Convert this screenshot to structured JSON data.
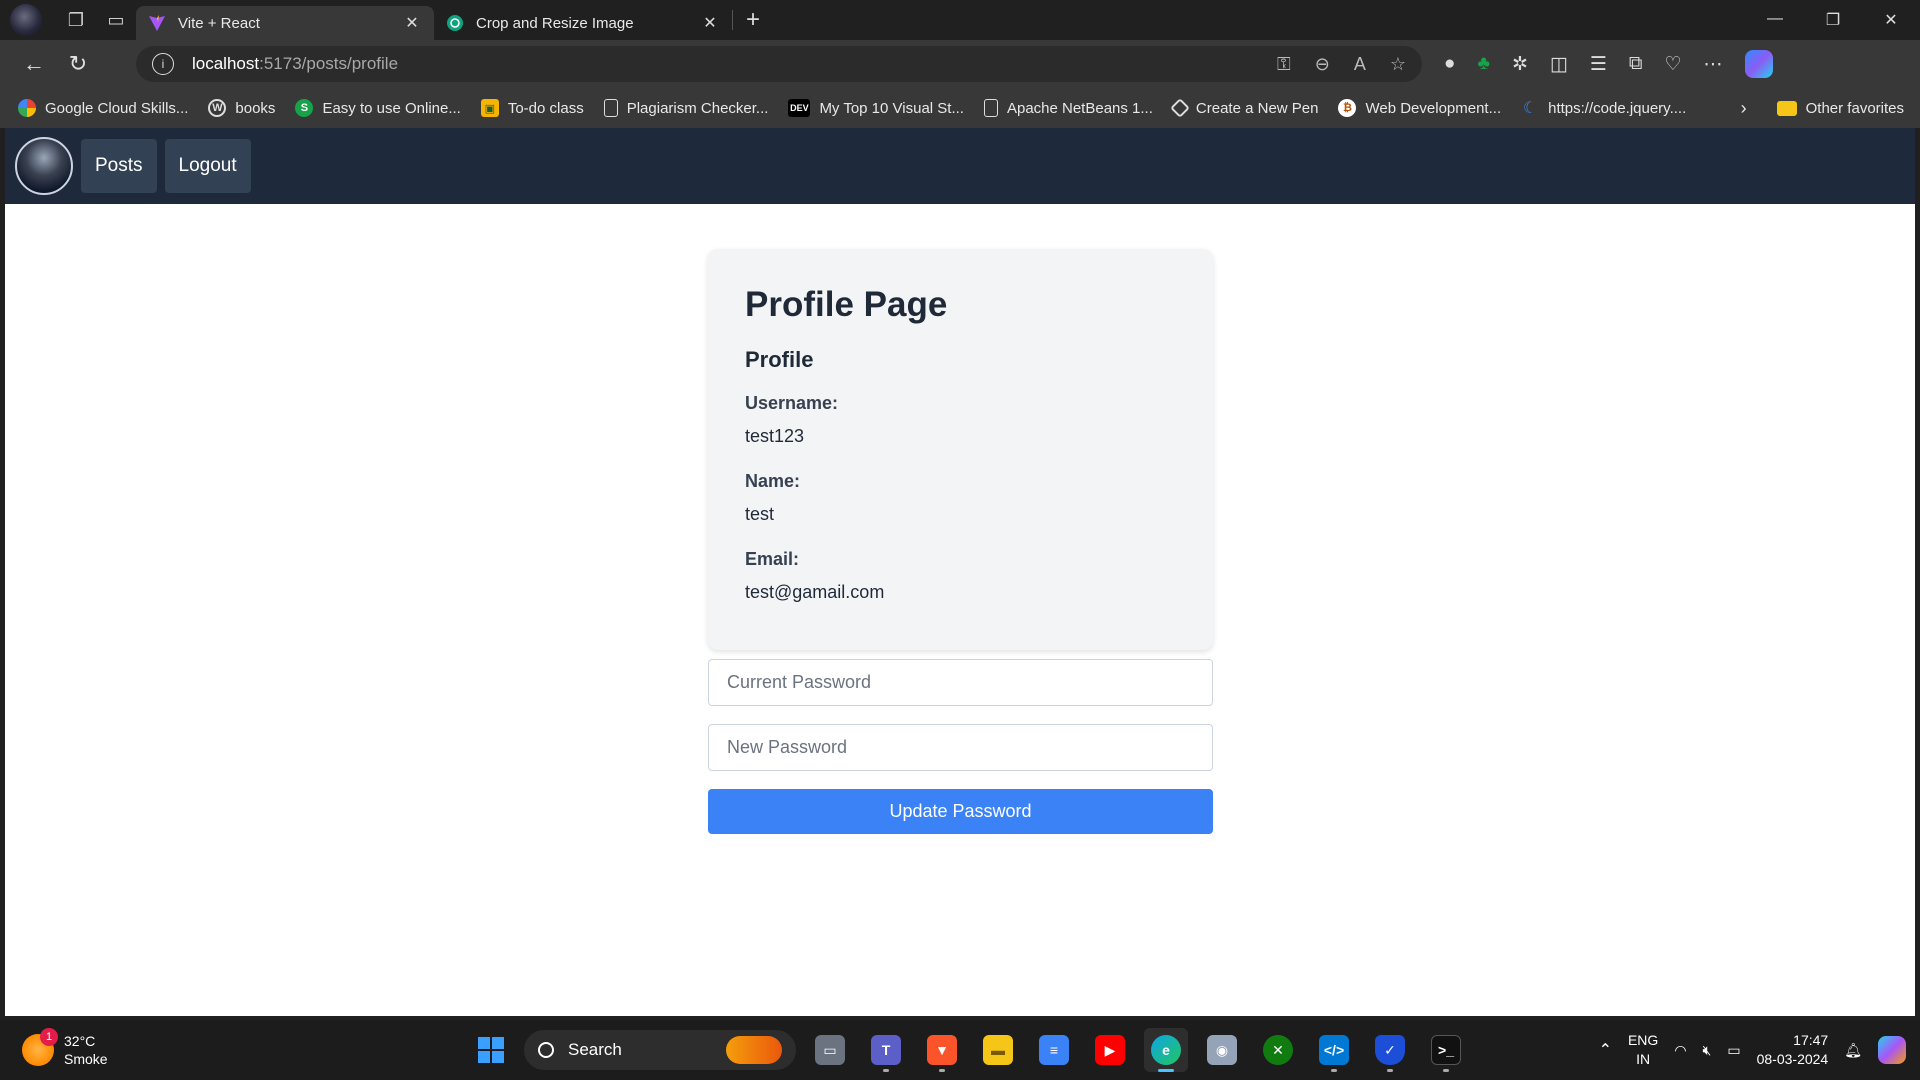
{
  "browser": {
    "tabs": [
      {
        "title": "Vite + React",
        "favicon": "vite-icon",
        "active": true
      },
      {
        "title": "Crop and Resize Image",
        "favicon": "chatgpt-icon",
        "active": false
      }
    ],
    "url_host": "localhost",
    "url_path": ":5173/posts/profile",
    "bookmarks": [
      {
        "label": "Google Cloud Skills...",
        "icon": "google-cloud-icon"
      },
      {
        "label": "books",
        "icon": "wordpress-icon"
      },
      {
        "label": "Easy to use Online...",
        "icon": "s-icon"
      },
      {
        "label": "To-do class",
        "icon": "classroom-icon"
      },
      {
        "label": "Plagiarism Checker...",
        "icon": "page-icon"
      },
      {
        "label": "My Top 10 Visual St...",
        "icon": "dev-icon"
      },
      {
        "label": "Apache NetBeans 1...",
        "icon": "page-icon"
      },
      {
        "label": "Create a New Pen",
        "icon": "codepen-icon"
      },
      {
        "label": "Web Development...",
        "icon": "coin-icon"
      },
      {
        "label": "https://code.jquery....",
        "icon": "jquery-icon"
      }
    ],
    "other_favorites": "Other favorites",
    "dev_badge": "DEV"
  },
  "app": {
    "nav": {
      "posts": "Posts",
      "logout": "Logout"
    },
    "profile": {
      "page_title": "Profile Page",
      "section_title": "Profile",
      "username_label": "Username:",
      "username": "test123",
      "name_label": "Name:",
      "name": "test",
      "email_label": "Email:",
      "email": "test@gamail.com"
    },
    "form": {
      "current_password_placeholder": "Current Password",
      "new_password_placeholder": "New Password",
      "submit_label": "Update Password"
    }
  },
  "taskbar": {
    "weather_temp": "32°C",
    "weather_desc": "Smoke",
    "weather_badge": "1",
    "search_label": "Search",
    "lang_top": "ENG",
    "lang_bottom": "IN",
    "time": "17:47",
    "date": "08-03-2024"
  },
  "colors": {
    "nav_bg": "#1e293b",
    "nav_button": "#334155",
    "primary": "#3b82f6",
    "card_bg": "#f3f4f6"
  }
}
